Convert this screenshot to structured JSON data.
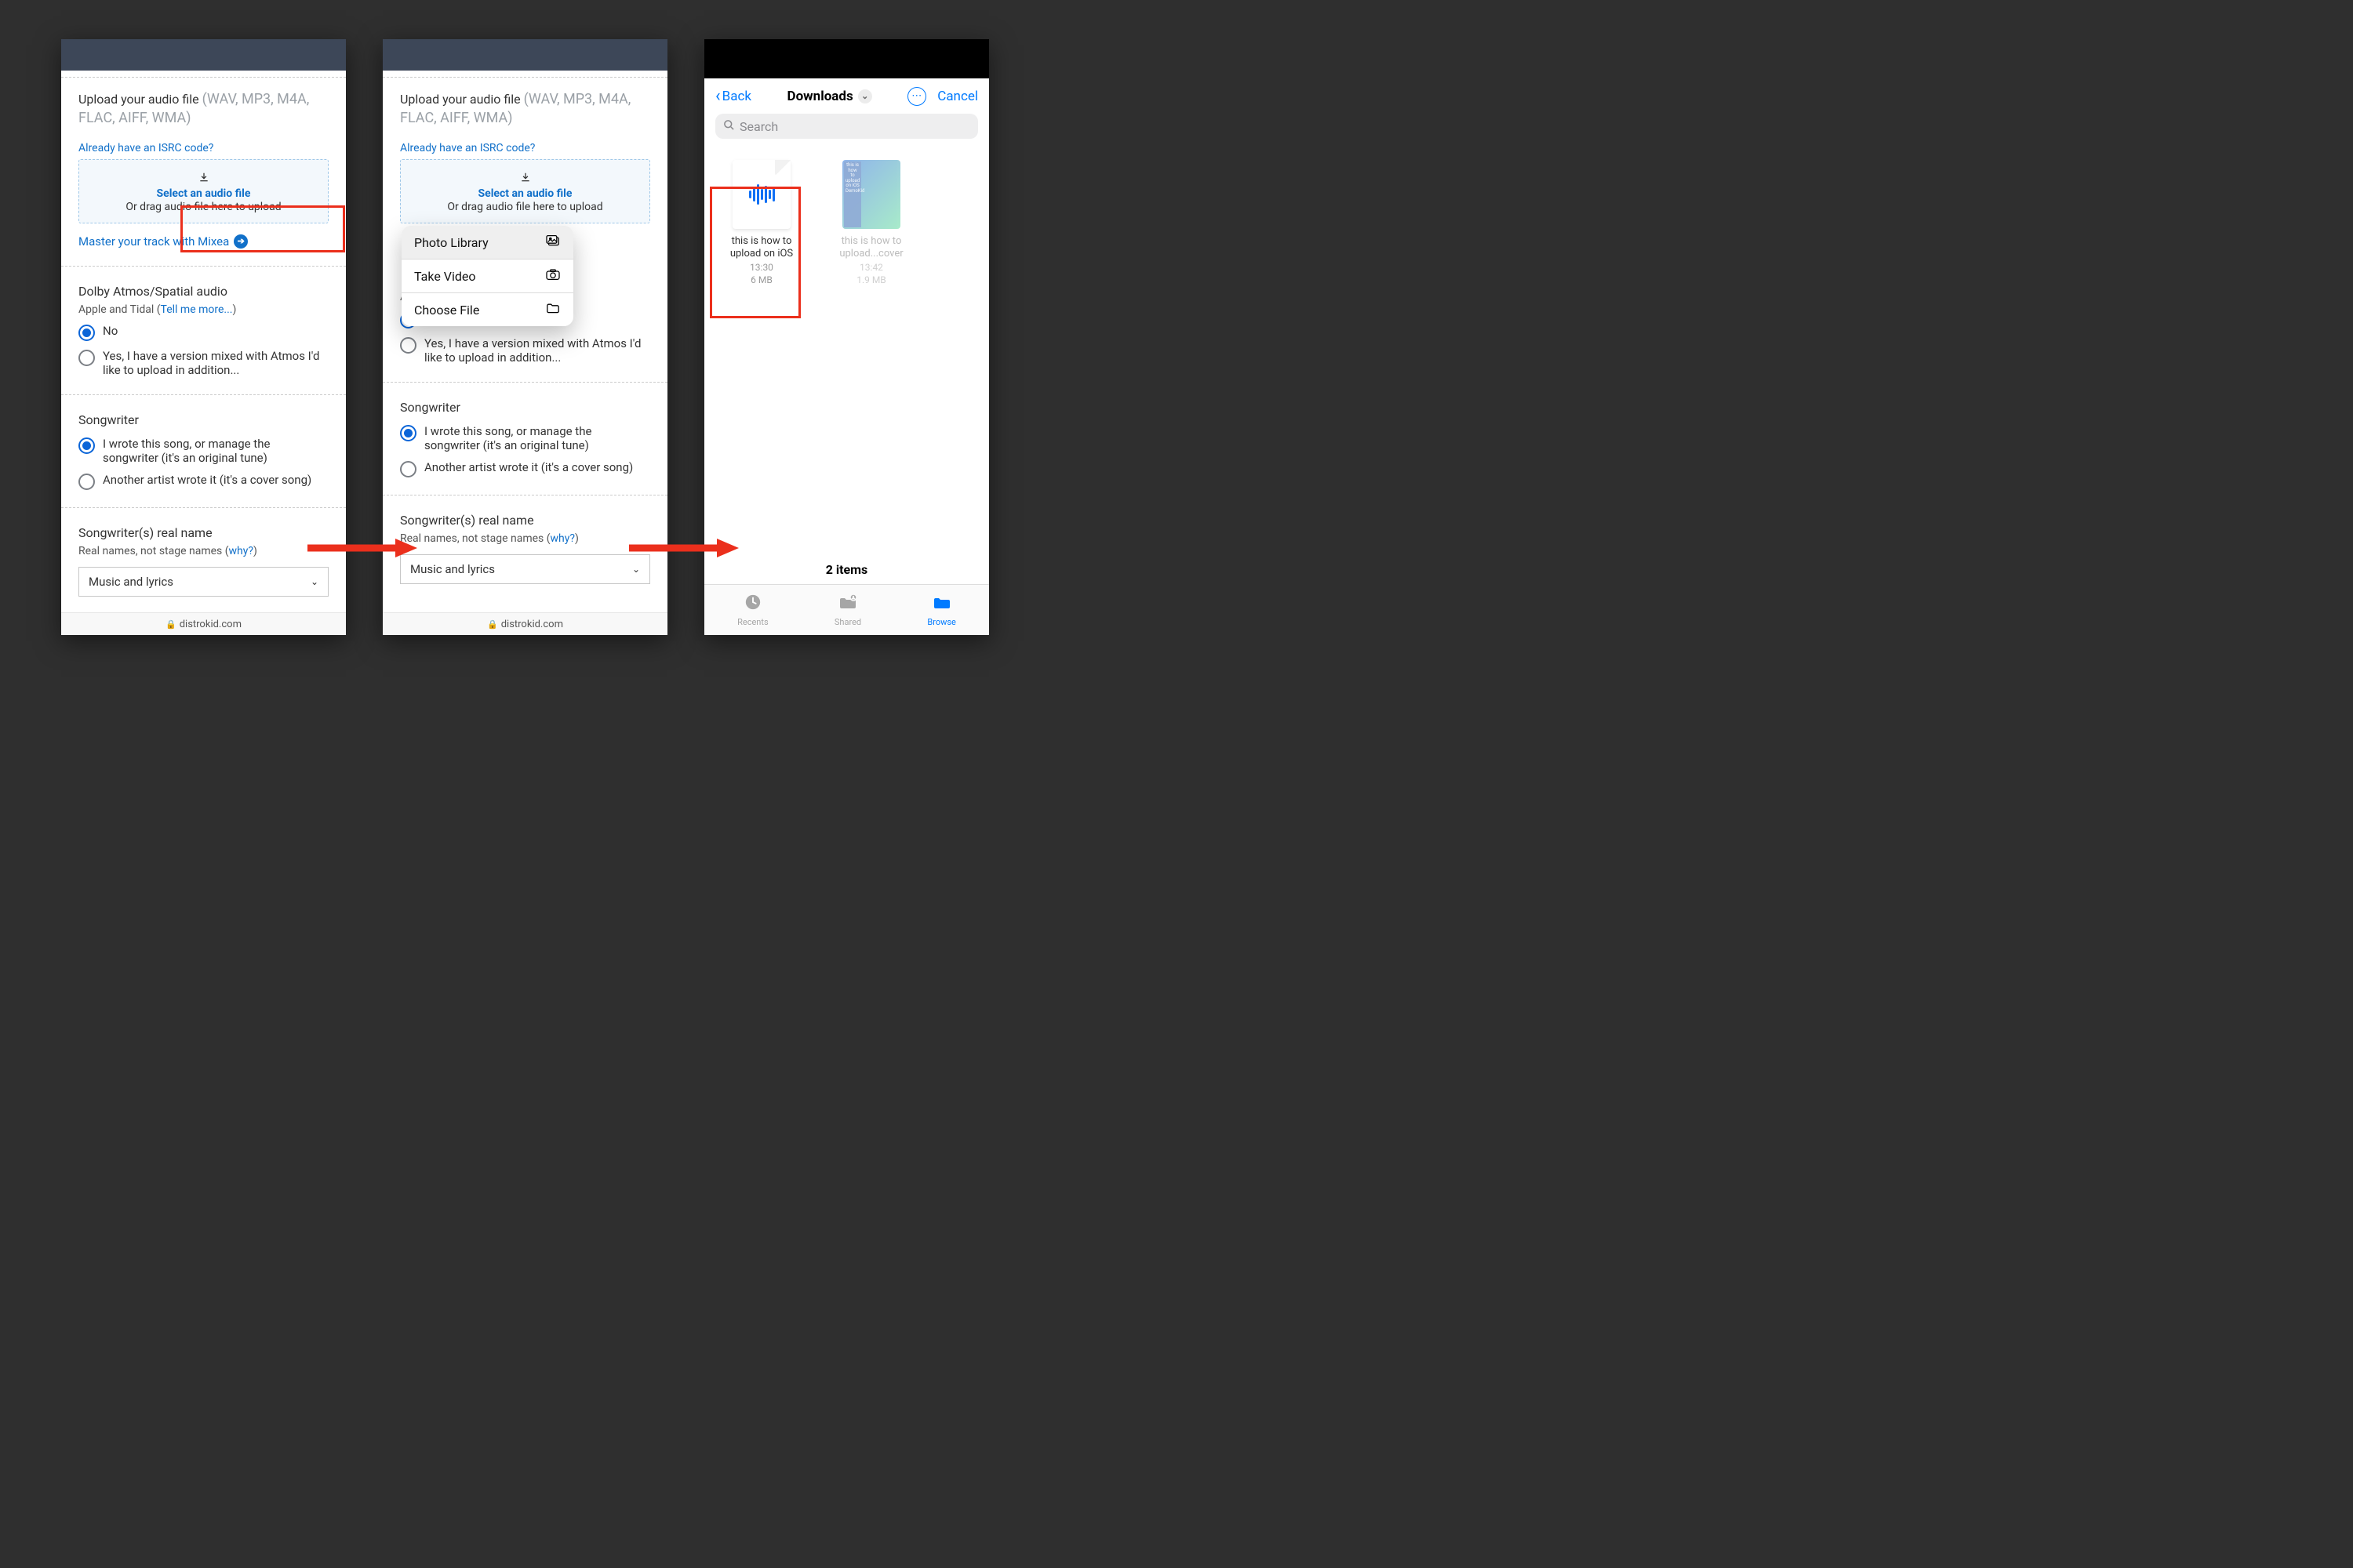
{
  "upload": {
    "heading": "Upload your audio file",
    "formats": "(WAV, MP3, M4A, FLAC, AIFF, WMA)",
    "isrc_link": "Already have an ISRC code?",
    "select": "Select an audio file",
    "drag": "Or drag audio file here to upload",
    "mixea": "Master your track with Mixea"
  },
  "dolby": {
    "heading": "Dolby Atmos/Spatial audio",
    "vendors": "Apple and Tidal (",
    "tell_more": "Tell me more...",
    "close": ")",
    "no": "No",
    "yes": "Yes, I have a version mixed with Atmos I'd like to upload in addition..."
  },
  "songwriter": {
    "heading": "Songwriter",
    "opt1": "I wrote this song, or manage the songwriter (it's an original tune)",
    "opt2": "Another artist wrote it (it's a cover song)"
  },
  "realname": {
    "heading": "Songwriter(s) real name",
    "note_pre": "Real names, not stage names (",
    "why": "why?",
    "note_post": ")",
    "select_value": "Music and lyrics"
  },
  "url": "distrokid.com",
  "sheet": {
    "photo": "Photo Library",
    "video": "Take Video",
    "file": "Choose File"
  },
  "files": {
    "back": "Back",
    "title": "Downloads",
    "cancel": "Cancel",
    "search": "Search",
    "item1_name": "this is how to upload on iOS",
    "item1_time": "13:30",
    "item1_size": "6 MB",
    "item2_name": "this is how to upload...cover",
    "item2_time": "13:42",
    "item2_size": "1.9 MB",
    "strip_text": "this is how to upload on iOS DemoKid",
    "count": "2 items",
    "tab_recents": "Recents",
    "tab_shared": "Shared",
    "tab_browse": "Browse"
  }
}
